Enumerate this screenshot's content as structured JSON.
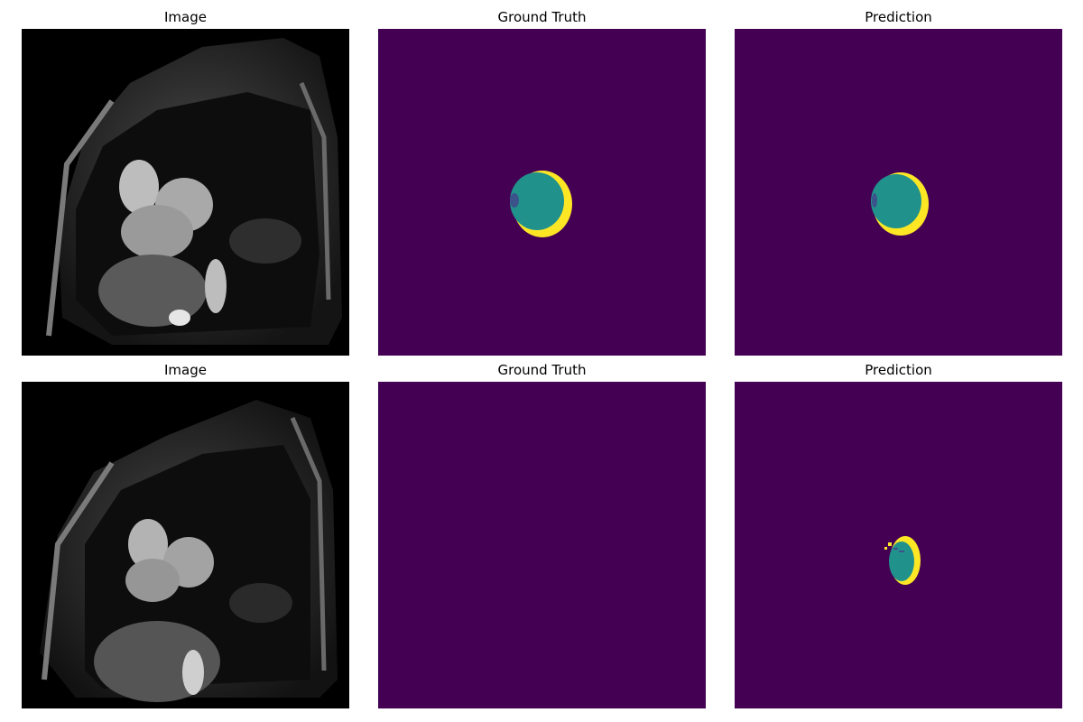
{
  "figure": {
    "rows": [
      {
        "panels": [
          {
            "title": "Image"
          },
          {
            "title": "Ground Truth"
          },
          {
            "title": "Prediction"
          }
        ]
      },
      {
        "panels": [
          {
            "title": "Image"
          },
          {
            "title": "Ground Truth"
          },
          {
            "title": "Prediction"
          }
        ]
      }
    ]
  },
  "colors": {
    "background": "#440154",
    "class_1": "#21918c",
    "class_2": "#fde725",
    "image_black": "#000000"
  }
}
